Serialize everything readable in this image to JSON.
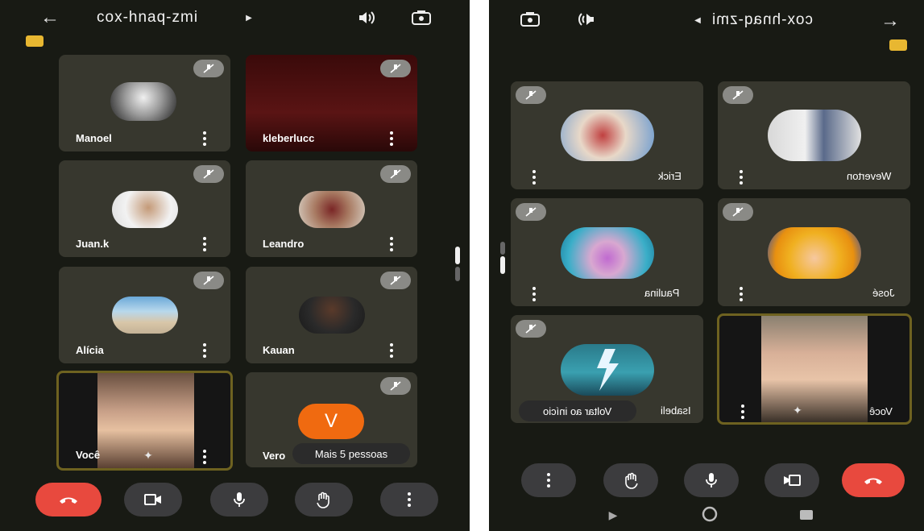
{
  "left": {
    "meeting_code": "cox-hnaq-zmi",
    "participants": [
      {
        "name": "Manoel"
      },
      {
        "name": "kleberlucc"
      },
      {
        "name": "Juan.k"
      },
      {
        "name": "Leandro"
      },
      {
        "name": "Alícia"
      },
      {
        "name": "Kauan"
      }
    ],
    "self_name": "Você",
    "overflow_initial": "V",
    "overflow_name": "Vero",
    "overflow_label": "Mais 5 pessoas"
  },
  "right": {
    "meeting_code": "cox-hnaq-zmi",
    "participants": [
      {
        "name": "Weverton"
      },
      {
        "name": "Erick"
      },
      {
        "name": "José"
      },
      {
        "name": "Paulina"
      },
      {
        "name": "Isabeli"
      }
    ],
    "self_name": "Você",
    "back_to_start": "Voltar ao início"
  },
  "colors": {
    "background": "#181a14",
    "tile": "#37372e",
    "end_call": "#e8493e",
    "accent_orange": "#f06a10",
    "self_border": "#6e6220"
  },
  "icons": [
    "back-arrow-icon",
    "speaker-icon",
    "switch-camera-icon",
    "hand-raise-icon",
    "mic-icon",
    "camera-icon",
    "end-call-icon",
    "more-options-icon",
    "muted-mic-icon",
    "sparkle-effects-icon"
  ]
}
